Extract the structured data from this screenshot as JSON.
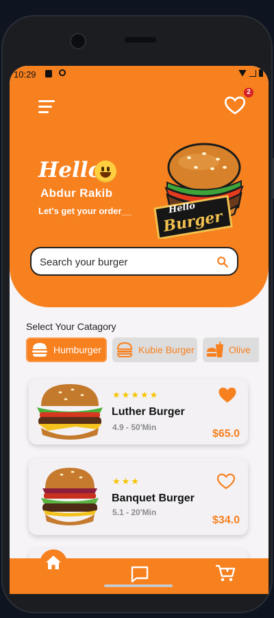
{
  "status": {
    "time": "10:29"
  },
  "header": {
    "greeting": "Hello",
    "user_name": "Abdur  Rakib",
    "subtitle": "Let's get your order__",
    "favorites_count": "2",
    "logo": {
      "line1": "Hello",
      "line2": "Burger"
    }
  },
  "search": {
    "placeholder": "Search your burger"
  },
  "categories": {
    "title": "Select Your Catagory",
    "items": [
      {
        "label": "Humburger",
        "active": true
      },
      {
        "label": "Kubie Burger",
        "active": false
      },
      {
        "label": "Olive",
        "active": false
      }
    ]
  },
  "products": [
    {
      "name": "Luther Burger",
      "stars": 5,
      "stars_text": "★★★★★",
      "meta": "4.9 - 50'Min",
      "price": "$65.0",
      "favorite": true
    },
    {
      "name": "Banquet Burger",
      "stars": 3,
      "stars_text": "★★★",
      "meta": "5.1 - 20'Min",
      "price": "$34.0",
      "favorite": false
    }
  ],
  "nav": {
    "items": [
      "home-icon",
      "chat-icon",
      "cart-icon"
    ]
  },
  "colors": {
    "primary": "#f7801f",
    "star": "#f7c300",
    "badge": "#d71f26"
  }
}
